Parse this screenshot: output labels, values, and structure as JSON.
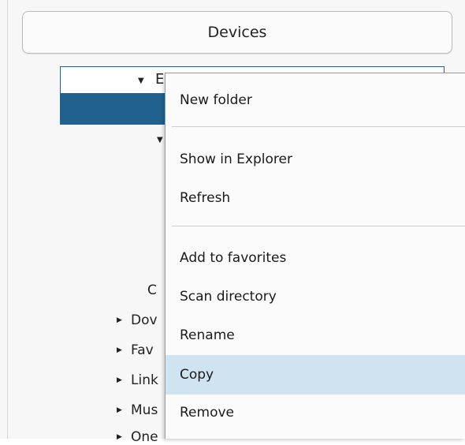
{
  "header": {
    "title": "Devices"
  },
  "tree": {
    "root_label": "E",
    "letter_c": "C",
    "items": [
      {
        "label": "Dov"
      },
      {
        "label": "Fav"
      },
      {
        "label": "Link"
      },
      {
        "label": "Mus"
      },
      {
        "label": "One"
      }
    ]
  },
  "context_menu": {
    "items": [
      {
        "label": "New folder"
      },
      {
        "label": "Show in Explorer"
      },
      {
        "label": "Refresh"
      },
      {
        "label": "Add to favorites"
      },
      {
        "label": "Scan directory"
      },
      {
        "label": "Rename"
      },
      {
        "label": "Copy"
      },
      {
        "label": "Remove"
      }
    ],
    "highlighted": "Copy",
    "highlight_color": "#cfe3f0"
  },
  "colors": {
    "selection": "#21618f"
  }
}
